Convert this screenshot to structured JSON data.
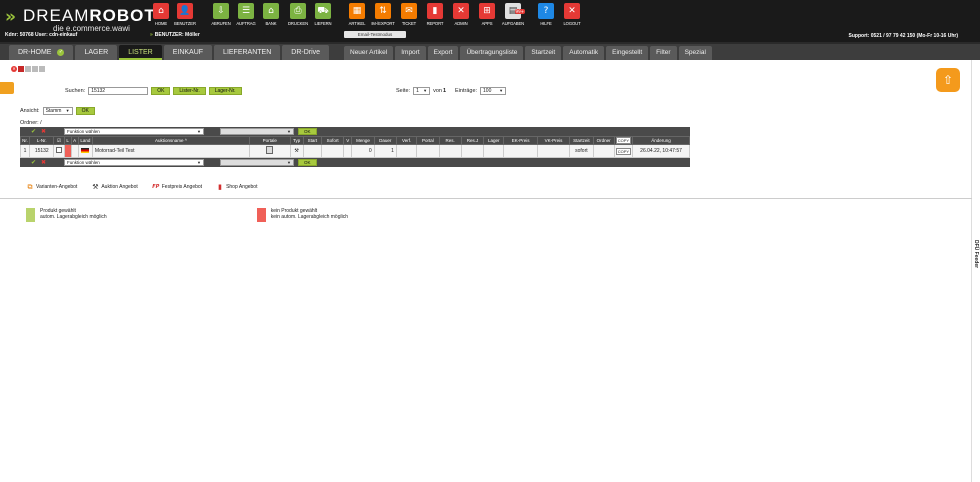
{
  "header": {
    "logo_chevrons": "»",
    "logo_dream": "DREAM",
    "logo_robot": "ROBOT",
    "logo_tagline": "die e.commerce.wawi",
    "kdnr": "Kdnr: 50768  User: cdn-einkauf",
    "benutzer": "BENUTZER: Möller",
    "support": "Support: 0521 / 97 79 42 150 (Mo-Fr 10-16 Uhr)",
    "email_bar": "Email-Testmodus"
  },
  "toolbar": [
    {
      "label": "HOME",
      "icon": "home-icon",
      "color": "#e53935",
      "glyph": "⌂"
    },
    {
      "label": "BENUTZER",
      "icon": "user-icon",
      "color": "#e53935",
      "glyph": "👤"
    },
    {
      "label": "ABRUFEN",
      "icon": "download-icon",
      "color": "#7cb342",
      "glyph": "⇩"
    },
    {
      "label": "AUFTRAG",
      "icon": "order-icon",
      "color": "#7cb342",
      "glyph": "☰"
    },
    {
      "label": "BANK",
      "icon": "bank-icon",
      "color": "#7cb342",
      "glyph": "⌂"
    },
    {
      "label": "DRUCKEN",
      "icon": "print-icon",
      "color": "#7cb342",
      "glyph": "⎙"
    },
    {
      "label": "LIEFERN",
      "icon": "truck-icon",
      "color": "#7cb342",
      "glyph": "⛟"
    },
    {
      "label": "ARTIKEL",
      "icon": "article-icon",
      "color": "#f57c00",
      "glyph": "▦"
    },
    {
      "label": "IM-/EXPORT",
      "icon": "import-export-icon",
      "color": "#f57c00",
      "glyph": "⇅"
    },
    {
      "label": "TICKET",
      "icon": "ticket-icon",
      "color": "#f57c00",
      "glyph": "✉"
    },
    {
      "label": "REPORT",
      "icon": "report-icon",
      "color": "#e53935",
      "glyph": "▮"
    },
    {
      "label": "ADMIN",
      "icon": "admin-icon",
      "color": "#e53935",
      "glyph": "✕"
    },
    {
      "label": "APPS",
      "icon": "apps-icon",
      "color": "#e53935",
      "glyph": "⊞"
    },
    {
      "label": "AUFGABEN",
      "icon": "tasks-icon",
      "color": "#e0e0e0",
      "glyph": "▤",
      "badge": "99+"
    },
    {
      "label": "HILFE",
      "icon": "help-icon",
      "color": "#1e88e5",
      "glyph": "?"
    },
    {
      "label": "LOGOUT",
      "icon": "logout-icon",
      "color": "#e53935",
      "glyph": "✕"
    }
  ],
  "nav": {
    "tabs": [
      "DR-HOME",
      "LAGER",
      "LISTER",
      "EINKAUF",
      "LIEFERANTEN",
      "DR-Drive"
    ],
    "active": "LISTER",
    "subtabs": [
      "Neuer Artikel",
      "Import",
      "Export",
      "Übertragungsliste",
      "Startzeit",
      "Automatik",
      "Eingestellt",
      "Filter",
      "Spezial"
    ]
  },
  "search": {
    "label": "Suchen:",
    "value": "15132",
    "ok": "OK",
    "lister_nr": "Lister-Nr.",
    "lager_nr": "Lager-Nr."
  },
  "paging": {
    "seite_label": "Seite:",
    "seite_value": "1",
    "von": "von",
    "total": "1",
    "eintraege_label": "Einträge:",
    "eintraege_value": "100"
  },
  "ansicht": {
    "label": "Ansicht:",
    "value": "Stamm",
    "ok": "OK"
  },
  "ordner": "Ordner: /",
  "actions": {
    "funktion_placeholder": "Funktion wählen",
    "ok": "OK"
  },
  "table": {
    "columns": [
      "Nr.",
      "L-Nr.",
      "☑",
      "L",
      "A",
      "Land",
      "Auktionsname ^",
      "Portale",
      "Typ",
      "Start",
      "Sofort",
      "V",
      "Menge",
      "Dauer",
      "Verf.",
      "Portal",
      "Res.",
      "Res.J",
      "Lager",
      "EK-Preis",
      "VK-Preis",
      "Startzeit",
      "Ordner",
      "COPY",
      "Änderung"
    ],
    "rows": [
      {
        "nr": "1",
        "lnr": "15132",
        "name": "Motorrad-Teil Test",
        "menge": "0",
        "dauer": "1",
        "startzeit": "sofort",
        "copy": "COPY",
        "aenderung": "26.04.22, 10:47:57"
      }
    ]
  },
  "offer_types": [
    {
      "label": "Varianten-Angebot",
      "icon": "variants-icon",
      "glyph": "⧉",
      "color": "#e57a00"
    },
    {
      "label": "Auktion Angebot",
      "icon": "hammer-icon",
      "glyph": "⚒",
      "color": "#333"
    },
    {
      "label": "Festpreis Angebot",
      "icon": "fixed-price-icon",
      "glyph": "FP",
      "color": "#d32f2f"
    },
    {
      "label": "Shop Angebot",
      "icon": "shop-bag-icon",
      "glyph": "▮",
      "color": "#d32f2f"
    }
  ],
  "legend": [
    {
      "color": "#b9d36c",
      "line1": "Produkt gewählt",
      "line2": "autom. Lagerabgleich möglich"
    },
    {
      "color": "#f06058",
      "line1": "kein Produkt gewählt",
      "line2": "kein autom. Lagerabgleich möglich"
    }
  ],
  "side_label": "DFÜ Feeder"
}
